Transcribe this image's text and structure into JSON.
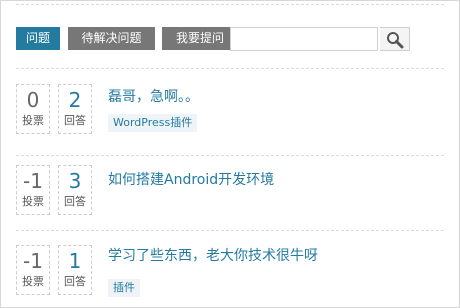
{
  "nav": {
    "questions_label": "问题",
    "unresolved_label": "待解决问题",
    "ask_label": "我要提问"
  },
  "search": {
    "value": "",
    "placeholder": "",
    "button_icon": "search-icon"
  },
  "questions": [
    {
      "votes": "0",
      "votes_label": "投票",
      "answers": "2",
      "answers_label": "回答",
      "title": "磊哥，急啊。。",
      "tag": "WordPress插件"
    },
    {
      "votes": "-1",
      "votes_label": "投票",
      "answers": "3",
      "answers_label": "回答",
      "title": "如何搭建Android开发环境",
      "tag": ""
    },
    {
      "votes": "-1",
      "votes_label": "投票",
      "answers": "1",
      "answers_label": "回答",
      "title": "学习了些东西，老大你技术很牛呀",
      "tag": "插件"
    }
  ],
  "colors": {
    "accent": "#247ba0",
    "nav_inactive": "#777777",
    "tag_bg": "#eef4f8"
  }
}
